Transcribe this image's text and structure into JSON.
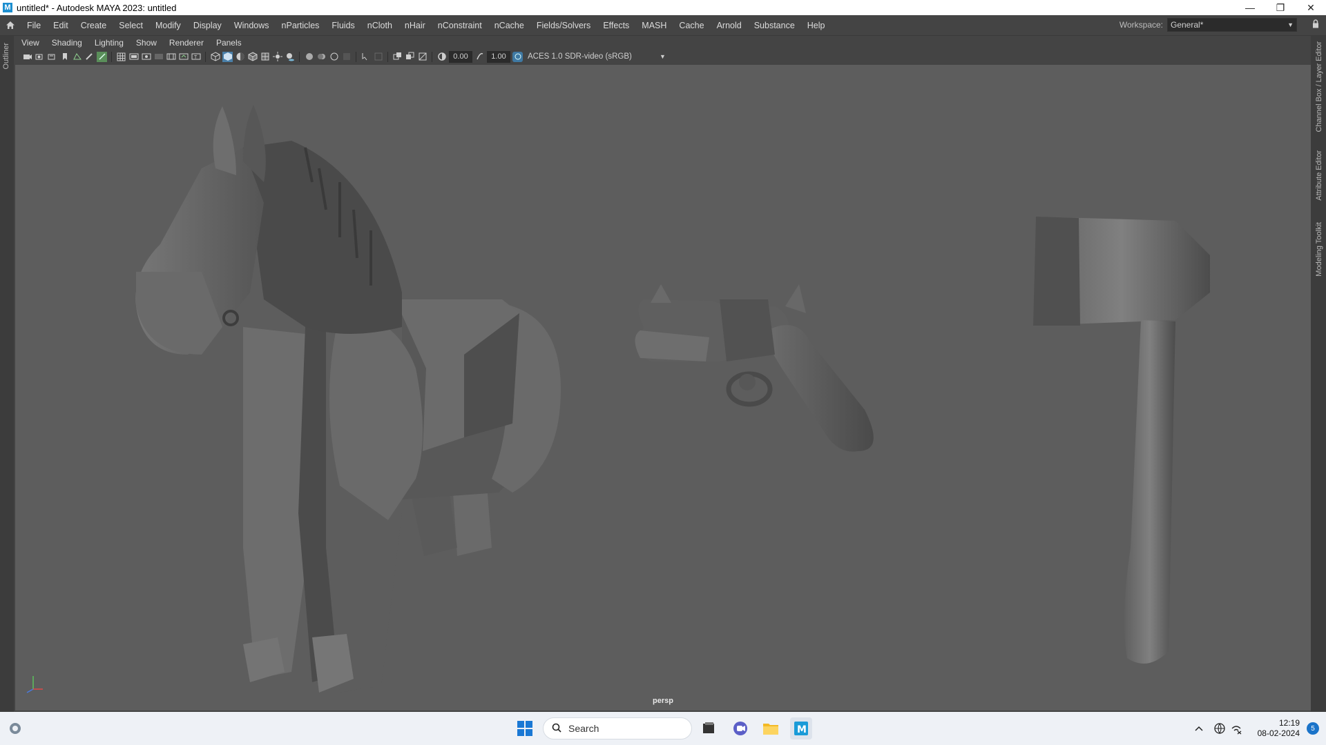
{
  "window": {
    "title": "untitled* - Autodesk MAYA 2023: untitled",
    "app_icon": "M",
    "controls": [
      "minimize-icon",
      "restore-icon",
      "close-icon"
    ]
  },
  "menubar": {
    "items": [
      "File",
      "Edit",
      "Create",
      "Select",
      "Modify",
      "Display",
      "Windows",
      "nParticles",
      "Fluids",
      "nCloth",
      "nHair",
      "nConstraint",
      "nCache",
      "Fields/Solvers",
      "Effects",
      "MASH",
      "Cache",
      "Arnold",
      "Substance",
      "Help"
    ],
    "workspace_label": "Workspace:",
    "workspace_value": "General*"
  },
  "left_panel": {
    "label": "Outliner"
  },
  "right_panel": {
    "tabs": [
      "Channel Box / Layer Editor",
      "Attribute Editor",
      "Modeling Toolkit"
    ]
  },
  "panel_menu": {
    "items": [
      "View",
      "Shading",
      "Lighting",
      "Show",
      "Renderer",
      "Panels"
    ]
  },
  "toolbar": {
    "exposure": "0.00",
    "gamma": "1.00",
    "color_space": "ACES 1.0 SDR-video (sRGB)"
  },
  "viewport": {
    "camera": "persp",
    "background": "#5d5d5d",
    "objects": [
      "horse",
      "pistol",
      "axe"
    ]
  },
  "taskbar": {
    "search_placeholder": "Search",
    "time": "12:19",
    "date": "08-02-2024",
    "notification_count": "5",
    "apps": [
      "windows-start-icon",
      "task-view-icon",
      "teams-icon",
      "file-explorer-icon",
      "maya-icon"
    ]
  }
}
